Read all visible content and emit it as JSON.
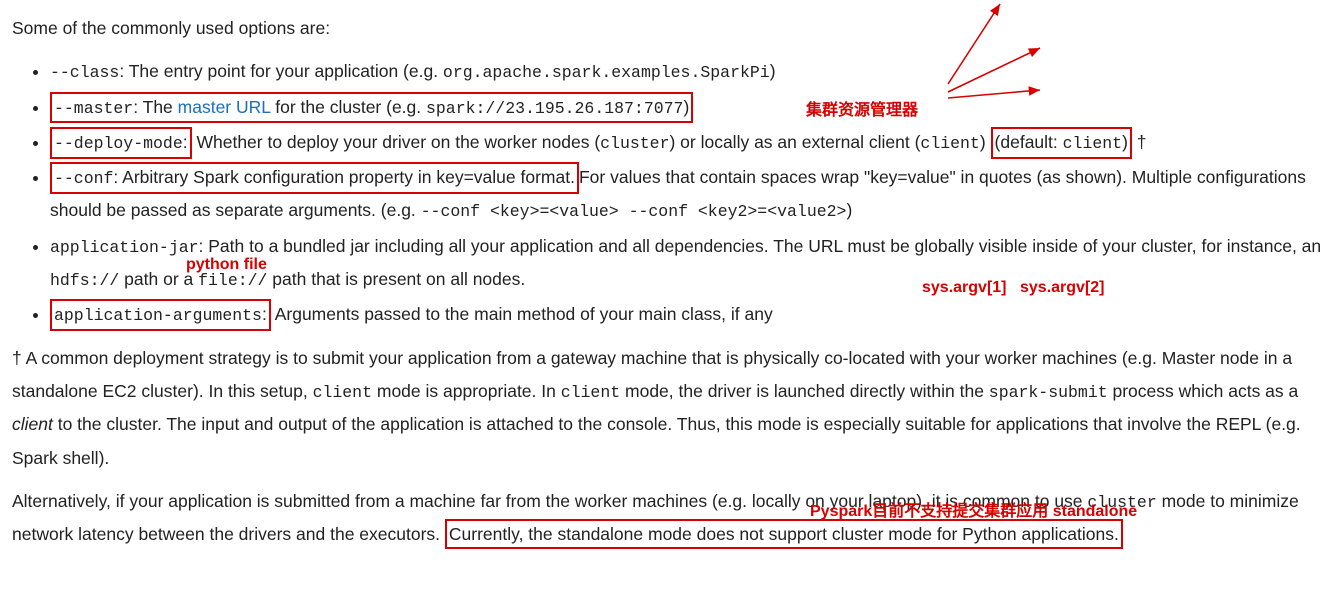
{
  "intro": "Some of the commonly used options are:",
  "items": {
    "class": {
      "opt": "--class",
      "text_a": ": The entry point for your application (e.g. ",
      "eg": "org.apache.spark.examples.SparkPi",
      "text_b": ")"
    },
    "master": {
      "opt": "--master",
      "text_a": ": The ",
      "link": "master URL",
      "text_b": " for the cluster (e.g. ",
      "eg": "spark://23.195.26.187:7077",
      "text_c": ")"
    },
    "deploy": {
      "opt": "--deploy-mode",
      "colon": ":",
      "text_a": " Whether to deploy your driver on the worker nodes (",
      "c1": "cluster",
      "text_b": ") or locally as an external client (",
      "c2": "client",
      "text_c": ") ",
      "box2_a": "(default: ",
      "box2_code": "client",
      "box2_b": ")",
      "dagger": " †"
    },
    "conf": {
      "opt": "--conf",
      "text_a": ": Arbitrary Spark configuration property in key=value format. ",
      "text_b": "For values that contain spaces wrap \"key=value\" in quotes (as shown). Multiple configurations should be passed as separate arguments. (e.g. ",
      "eg": "--conf <key>=<value> --conf <key2>=<value2>",
      "text_c": ")"
    },
    "jar": {
      "opt": "application-jar",
      "text_a": ": Path to a bundled jar including all your application and all dependencies. The URL must be globally visible inside of your cluster, for instance, an ",
      "c1": "hdfs://",
      "text_b": " path or a ",
      "c2": "file://",
      "text_c": " path that is present on all nodes."
    },
    "args": {
      "opt": "application-arguments",
      "colon": ":",
      "text_a": " Arguments passed to the main method of your main class, if any"
    }
  },
  "para1": {
    "a": "† A common deployment strategy is to submit your application from a gateway machine that is physically co-located with your worker machines (e.g. Master node in a standalone EC2 cluster). In this setup, ",
    "c1": "client",
    "b": " mode is appropriate. In ",
    "c2": "client",
    "c": " mode, the driver is launched directly within the ",
    "c3": "spark-submit",
    "d": " process which acts as a ",
    "em": "client",
    "e": " to the cluster. The input and output of the application is attached to the console. Thus, this mode is especially suitable for applications that involve the REPL (e.g. Spark shell)."
  },
  "para2": {
    "a": "Alternatively, if your application is submitted from a machine far from the worker machines (e.g. locally on your laptop), it is common to use ",
    "c1": "cluster",
    "b": " mode to minimize network latency between the drivers and the executors. ",
    "boxed": "Currently, the standalone mode does not support cluster mode for Python applications."
  },
  "annotations": {
    "cluster_mgr": "集群资源管理器",
    "python_file": "python file",
    "argv1": "sys.argv[1]",
    "argv2": "sys.argv[2]",
    "pyspark_note": "Pyspark目前不支持提交集群应用  standalone"
  }
}
